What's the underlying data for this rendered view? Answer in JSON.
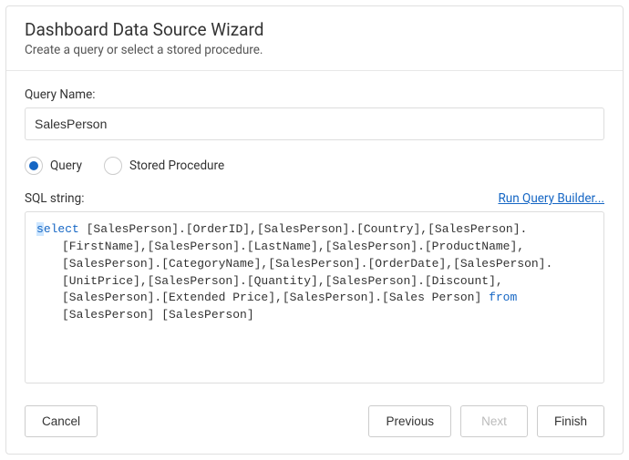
{
  "header": {
    "title": "Dashboard Data Source Wizard",
    "subtitle": "Create a query or select a stored procedure."
  },
  "form": {
    "query_name_label": "Query Name:",
    "query_name_value": "SalesPerson",
    "radio_query": "Query",
    "radio_stored_proc": "Stored Procedure",
    "sql_string_label": "SQL string:",
    "query_builder_link": "Run Query Builder...",
    "sql_prefix_char": "s",
    "sql_keyword_select_rest": "elect",
    "sql_body_1": " [SalesPerson].[OrderID],[SalesPerson].[Country],[SalesPerson].[FirstName],[SalesPerson].[LastName],[SalesPerson].[ProductName],[SalesPerson].[CategoryName],[SalesPerson].[OrderDate],[SalesPerson].[UnitPrice],[SalesPerson].[Quantity],[SalesPerson].[Discount],[SalesPerson].[Extended Price],[SalesPerson].[Sales Person] ",
    "sql_keyword_from": "from",
    "sql_body_2": " [SalesPerson] [SalesPerson]"
  },
  "footer": {
    "cancel": "Cancel",
    "previous": "Previous",
    "next": "Next",
    "finish": "Finish"
  }
}
